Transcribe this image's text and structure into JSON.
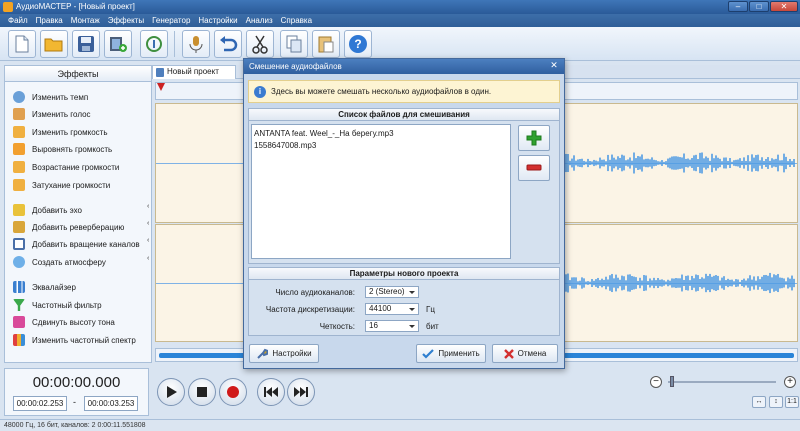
{
  "window": {
    "title": "АудиоМАСТЕР - [Новый проект]",
    "buttons": [
      "–",
      "□",
      "✕"
    ]
  },
  "menu": [
    "Файл",
    "Правка",
    "Монтаж",
    "Эффекты",
    "Генератор",
    "Настройки",
    "Анализ",
    "Справка"
  ],
  "left_panel": {
    "header": "Эффекты",
    "items": [
      {
        "label": "Изменить темп",
        "icon": "clock-icon"
      },
      {
        "label": "Изменить голос",
        "icon": "voice-icon"
      },
      {
        "label": "Изменить громкость",
        "icon": "volume-icon"
      },
      {
        "label": "Выровнять громкость",
        "icon": "equalize-volume-icon"
      },
      {
        "label": "Возрастание громкости",
        "icon": "fade-in-icon"
      },
      {
        "label": "Затухание громкости",
        "icon": "fade-out-icon"
      },
      {
        "label": "Добавить эхо",
        "icon": "echo-icon"
      },
      {
        "label": "Добавить реверберацию",
        "icon": "reverb-icon"
      },
      {
        "label": "Добавить вращение каналов",
        "icon": "channel-rotate-icon"
      },
      {
        "label": "Создать атмосферу",
        "icon": "atmosphere-icon"
      },
      {
        "label": "Эквалайзер",
        "icon": "equalizer-icon"
      },
      {
        "label": "Частотный фильтр",
        "icon": "filter-icon"
      },
      {
        "label": "Сдвинуть высоту тона",
        "icon": "pitch-icon"
      },
      {
        "label": "Изменить частотный спектр",
        "icon": "spectrum-icon"
      }
    ]
  },
  "editor": {
    "tab_label": "Новый проект"
  },
  "time": {
    "current": "00:00:00.000",
    "sel_start": "00:00:02.253",
    "sel_end": "00:00:03.253",
    "dash": "-"
  },
  "zoom": {
    "minus": "−",
    "plus": "+",
    "fit_h": "↔",
    "fit_v": "↕",
    "ratio": "1:1"
  },
  "status": "48000 Гц, 16 бит, каналов: 2   0:00:11.551808",
  "dialog": {
    "title": "Смешение аудиофайлов",
    "close": "✕",
    "info_icon": "i",
    "info": "Здесь вы можете смешать несколько аудиофайлов в один.",
    "files_header": "Список файлов для смешивания",
    "files": [
      "ANTANTA feat. Weel_-_На берегу.mp3",
      "1558647008.mp3"
    ],
    "params_header": "Параметры нового проекта",
    "channels_label": "Число аудиоканалов:",
    "channels_value": "2 (Stereo)",
    "rate_label": "Частота дискретизации:",
    "rate_value": "44100",
    "rate_unit": "Гц",
    "bits_label": "Четкость:",
    "bits_value": "16",
    "bits_unit": "бит",
    "settings_button": "Настройки",
    "apply_button": "Применить",
    "cancel_button": "Отмена"
  },
  "colors": {
    "accent": "#2a84d8",
    "waveform": "#4f9be4",
    "track_bg": "#fbf4e6",
    "titlebar": "#2f5f9f",
    "add": "#2fa12f",
    "remove": "#d33030"
  }
}
